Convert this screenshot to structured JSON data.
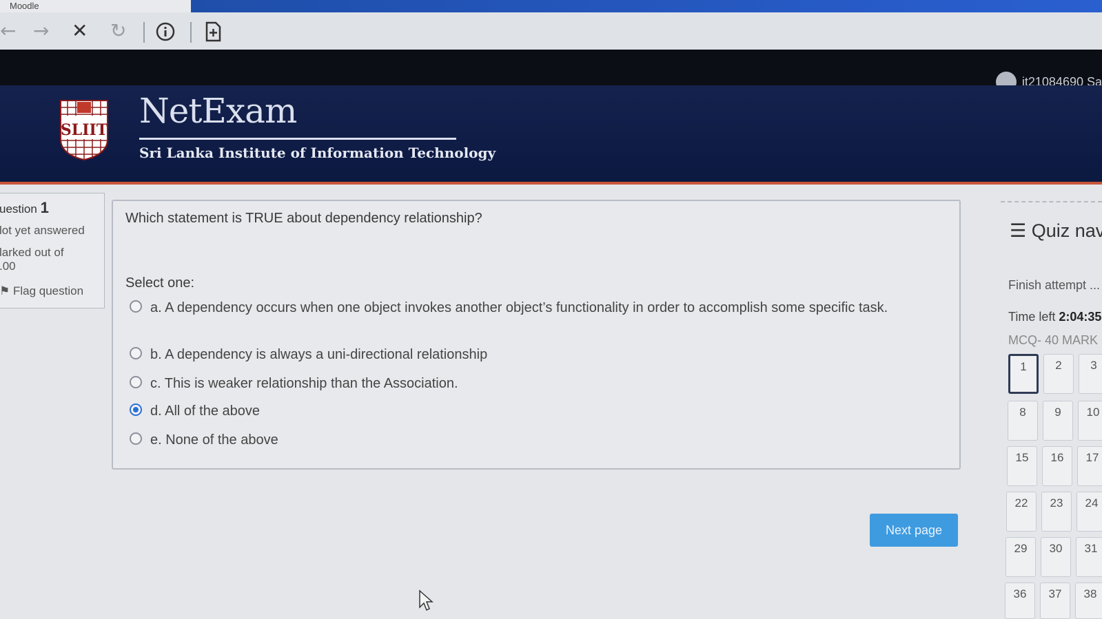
{
  "browser": {
    "tab_title": "Moodle",
    "icons": [
      "back-arrow-icon",
      "forward-arrow-icon",
      "stop-icon",
      "reload-icon",
      "info-icon",
      "add-bookmark-icon"
    ]
  },
  "user": {
    "name": "it21084690 Sa"
  },
  "header": {
    "brand": "NetExam",
    "subtitle": "Sri Lanka Institute of Information Technology",
    "logo_text": "SLIIT"
  },
  "question_info": {
    "label": "uestion",
    "number": "1",
    "state": "lot yet answered",
    "marks_line1": "larked out of",
    "marks_line2": ".00",
    "flag_label": "Flag question"
  },
  "question": {
    "text": "Which statement is TRUE about dependency relationship?",
    "select_label": "Select one:",
    "options": [
      {
        "label": "a. A dependency occurs when one object invokes another object’s functionality in order to accomplish some specific task.",
        "checked": false
      },
      {
        "label": "b. A dependency is always a uni-directional relationship",
        "checked": false
      },
      {
        "label": "c. This is weaker relationship than the Association.",
        "checked": false
      },
      {
        "label": "d. All of the above",
        "checked": true
      },
      {
        "label": "e. None of the above",
        "checked": false
      }
    ]
  },
  "next_button": "Next page",
  "quiz_nav": {
    "title": "Quiz nav",
    "finish": "Finish attempt ...",
    "time_label": "Time left",
    "time_value": "2:04:35",
    "section": "MCQ- 40 MARK",
    "buttons": [
      "1",
      "2",
      "3",
      "8",
      "9",
      "10",
      "15",
      "16",
      "17",
      "22",
      "23",
      "24",
      "29",
      "30",
      "31",
      "36",
      "37",
      "38"
    ],
    "current": "1"
  },
  "colors": {
    "header_bg": "#0d1b45",
    "accent_line": "#c9543a",
    "button_blue": "#3e9be0",
    "radio_checked": "#2a6fd6"
  }
}
